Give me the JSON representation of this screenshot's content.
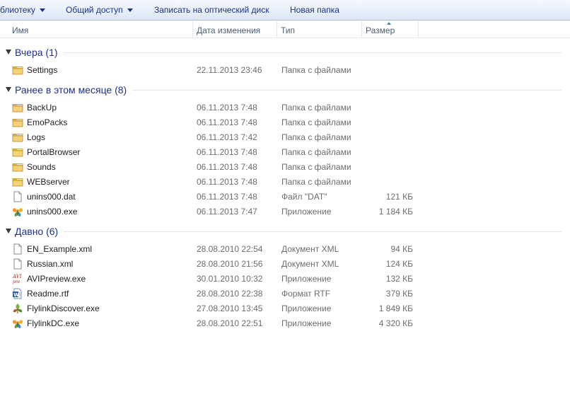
{
  "toolbar": {
    "library_label": "блиотеку",
    "share_label": "Общий доступ",
    "burn_label": "Записать на оптический диск",
    "new_folder_label": "Новая папка"
  },
  "columns": {
    "name": "Имя",
    "date": "Дата изменения",
    "type": "Тип",
    "size": "Размер"
  },
  "groups": [
    {
      "label": "Вчера (1)",
      "items": [
        {
          "name": "Settings",
          "date": "22.11.2013 23:46",
          "type": "Папка с файлами",
          "size": "",
          "icon": "folder-icon"
        }
      ]
    },
    {
      "label": "Ранее в этом месяце (8)",
      "items": [
        {
          "name": "BackUp",
          "date": "06.11.2013 7:48",
          "type": "Папка с файлами",
          "size": "",
          "icon": "folder-icon"
        },
        {
          "name": "EmoPacks",
          "date": "06.11.2013 7:48",
          "type": "Папка с файлами",
          "size": "",
          "icon": "folder-icon"
        },
        {
          "name": "Logs",
          "date": "06.11.2013 7:42",
          "type": "Папка с файлами",
          "size": "",
          "icon": "folder-icon"
        },
        {
          "name": "PortalBrowser",
          "date": "06.11.2013 7:48",
          "type": "Папка с файлами",
          "size": "",
          "icon": "folder-icon"
        },
        {
          "name": "Sounds",
          "date": "06.11.2013 7:48",
          "type": "Папка с файлами",
          "size": "",
          "icon": "folder-icon"
        },
        {
          "name": "WEBserver",
          "date": "06.11.2013 7:48",
          "type": "Папка с файлами",
          "size": "",
          "icon": "folder-icon"
        },
        {
          "name": "unins000.dat",
          "date": "06.11.2013 7:48",
          "type": "Файл \"DAT\"",
          "size": "121 КБ",
          "icon": "file-icon"
        },
        {
          "name": "unins000.exe",
          "date": "06.11.2013 7:47",
          "type": "Приложение",
          "size": "1 184 КБ",
          "icon": "butterfly-icon"
        }
      ]
    },
    {
      "label": "Давно (6)",
      "items": [
        {
          "name": "EN_Example.xml",
          "date": "28.08.2010 22:54",
          "type": "Документ XML",
          "size": "94 КБ",
          "icon": "file-icon"
        },
        {
          "name": "Russian.xml",
          "date": "28.08.2010 21:56",
          "type": "Документ XML",
          "size": "124 КБ",
          "icon": "file-icon"
        },
        {
          "name": "AVIPreview.exe",
          "date": "30.01.2010 10:32",
          "type": "Приложение",
          "size": "132 КБ",
          "icon": "avi-icon"
        },
        {
          "name": "Readme.rtf",
          "date": "28.08.2010 22:38",
          "type": "Формат RTF",
          "size": "379 КБ",
          "icon": "word-icon"
        },
        {
          "name": "FlylinkDiscover.exe",
          "date": "27.08.2010 13:45",
          "type": "Приложение",
          "size": "1 849 КБ",
          "icon": "leaf-icon"
        },
        {
          "name": "FlylinkDC.exe",
          "date": "28.08.2010 22:51",
          "type": "Приложение",
          "size": "4 320 КБ",
          "icon": "butterfly-icon"
        }
      ]
    }
  ]
}
